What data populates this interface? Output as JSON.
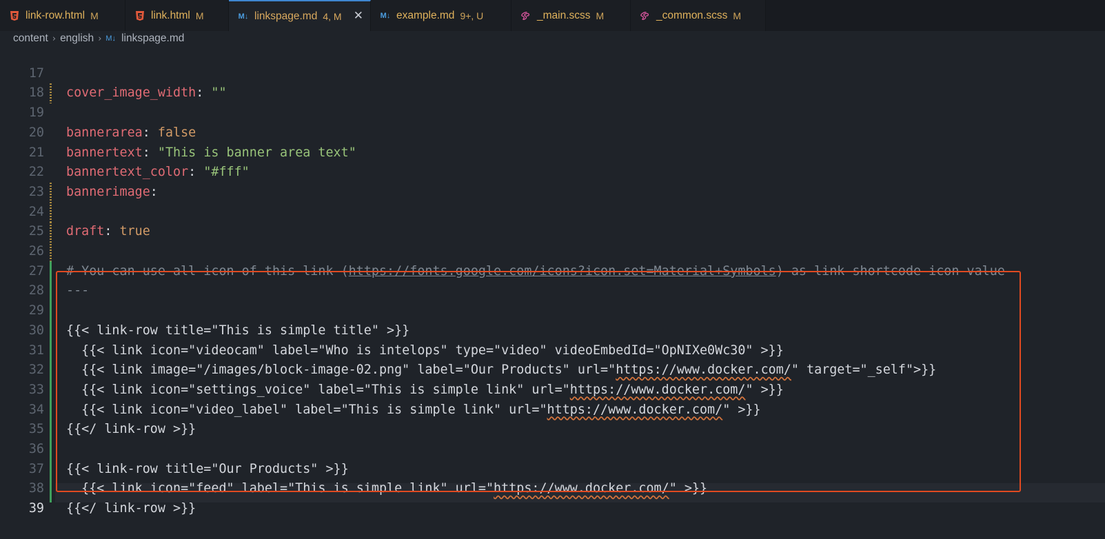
{
  "tabs": [
    {
      "name": "link-row.html",
      "badge": "M",
      "icon": "html5-icon",
      "active": false
    },
    {
      "name": "link.html",
      "badge": "M",
      "icon": "html5-icon",
      "active": false
    },
    {
      "name": "linkspage.md",
      "badge": "4, M",
      "icon": "markdown-icon",
      "active": true,
      "close": "✕"
    },
    {
      "name": "example.md",
      "badge": "9+, U",
      "icon": "markdown-icon",
      "active": false
    },
    {
      "name": "_main.scss",
      "badge": "M",
      "icon": "sass-icon",
      "active": false
    },
    {
      "name": "_common.scss",
      "badge": "M",
      "icon": "sass-icon",
      "active": false
    }
  ],
  "breadcrumb": {
    "parts": [
      "content",
      "english"
    ],
    "file": "linkspage.md"
  },
  "editor": {
    "line_numbers": [
      "17",
      "18",
      "19",
      "20",
      "21",
      "22",
      "23",
      "24",
      "25",
      "26",
      "27",
      "28",
      "29",
      "30",
      "31",
      "32",
      "33",
      "34",
      "35",
      "36",
      "37",
      "38",
      "39"
    ],
    "lines": {
      "l17": {
        "key": "cover_image_width",
        "val": "\"\""
      },
      "l19": {
        "key": "bannerarea",
        "val": "false"
      },
      "l20": {
        "key": "bannertext",
        "val": "\"This is banner area text\""
      },
      "l21": {
        "key": "bannertext_color",
        "val": "\"#fff\""
      },
      "l22": {
        "key": "bannerimage"
      },
      "l24": {
        "key": "draft",
        "val": "true"
      },
      "l26": {
        "pre": "# You can use all icon of this link (",
        "url": "https://fonts.google.com/icons?icon.set=Material+Symbols",
        "post": ") as link shortcode icon value"
      },
      "l27": "---",
      "l29": "{{< link-row title=\"This is simple title\" >}}",
      "l30": "  {{< link icon=\"videocam\" label=\"Who is intelops\" type=\"video\" videoEmbedId=\"OpNIXe0Wc30\" >}}",
      "l31": {
        "pre": "  {{< link image=\"/images/block-image-02.png\" label=\"Our Products\" url=\"",
        "url": "https://www.docker.com/",
        "post": "\" target=\"_self\">}}"
      },
      "l32": {
        "pre": "  {{< link icon=\"settings_voice\" label=\"This is simple link\" url=\"",
        "url": "https://www.docker.com/",
        "post": "\" >}}"
      },
      "l33": {
        "pre": "  {{< link icon=\"video_label\" label=\"This is simple link\" url=\"",
        "url": "https://www.docker.com/",
        "post": "\" >}}"
      },
      "l34": "{{</ link-row >}}",
      "l36": "{{< link-row title=\"Our Products\" >}}",
      "l37": {
        "pre": "  {{< link icon=\"feed\" label=\"This is simple link\" url=\"",
        "url": "https://www.docker.com/",
        "post": "\" >}}"
      },
      "l38": "{{</ link-row >}}"
    }
  },
  "colors": {
    "highlight_box": "#e04a21",
    "active_tab_border": "#3e86d0",
    "key": "#e06b74",
    "string": "#98c379",
    "bool": "#d19a66",
    "comment": "#7f8892"
  }
}
